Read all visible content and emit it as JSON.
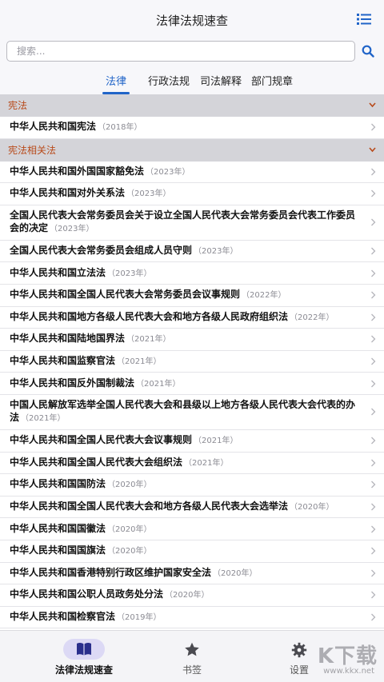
{
  "header": {
    "title": "法律法规速查",
    "menu_icon": "list-icon"
  },
  "search": {
    "placeholder": "搜索..."
  },
  "tabs": [
    {
      "label": "法律",
      "active": true
    },
    {
      "label": "行政法规",
      "active": false
    },
    {
      "label": "司法解释",
      "active": false
    },
    {
      "label": "部门规章",
      "active": false
    }
  ],
  "sections": [
    {
      "title": "宪法",
      "icon": "chevron-down-icon"
    },
    {
      "title": "宪法相关法",
      "icon": "chevron-down-icon"
    }
  ],
  "items": [
    {
      "name": "中华人民共和国宪法",
      "year": "（2018年）"
    },
    {
      "name": "中华人民共和国外国国家豁免法",
      "year": "（2023年）"
    },
    {
      "name": "中华人民共和国对外关系法",
      "year": "（2023年）"
    },
    {
      "name": "全国人民代表大会常务委员会关于设立全国人民代表大会常务委员会代表工作委员会的决定",
      "year": "（2023年）"
    },
    {
      "name": "全国人民代表大会常务委员会组成人员守则",
      "year": "（2023年）"
    },
    {
      "name": "中华人民共和国立法法",
      "year": "（2023年）"
    },
    {
      "name": "中华人民共和国全国人民代表大会常务委员会议事规则",
      "year": "（2022年）"
    },
    {
      "name": "中华人民共和国地方各级人民代表大会和地方各级人民政府组织法",
      "year": "（2022年）"
    },
    {
      "name": "中华人民共和国陆地国界法",
      "year": "（2021年）"
    },
    {
      "name": "中华人民共和国监察官法",
      "year": "（2021年）"
    },
    {
      "name": "中华人民共和国反外国制裁法",
      "year": "（2021年）"
    },
    {
      "name": "中国人民解放军选举全国人民代表大会和县级以上地方各级人民代表大会代表的办法",
      "year": "（2021年）"
    },
    {
      "name": "中华人民共和国全国人民代表大会议事规则",
      "year": "（2021年）"
    },
    {
      "name": "中华人民共和国全国人民代表大会组织法",
      "year": "（2021年）"
    },
    {
      "name": "中华人民共和国国防法",
      "year": "（2020年）"
    },
    {
      "name": "中华人民共和国全国人民代表大会和地方各级人民代表大会选举法",
      "year": "（2020年）"
    },
    {
      "name": "中华人民共和国国徽法",
      "year": "（2020年）"
    },
    {
      "name": "中华人民共和国国旗法",
      "year": "（2020年）"
    },
    {
      "name": "中华人民共和国香港特别行政区维护国家安全法",
      "year": "（2020年）"
    },
    {
      "name": "中华人民共和国公职人员政务处分法",
      "year": "（2020年）"
    },
    {
      "name": "中华人民共和国检察官法",
      "year": "（2019年）"
    }
  ],
  "bottom_nav": [
    {
      "label": "法律法规速查",
      "icon": "book-icon",
      "active": true
    },
    {
      "label": "书签",
      "icon": "star-icon",
      "active": false
    },
    {
      "label": "设置",
      "icon": "gear-icon",
      "active": false
    }
  ],
  "watermark": {
    "text": "K下载",
    "url": "www.kkx.net"
  },
  "colors": {
    "accent": "#2064c8",
    "section_text": "#b84a1a",
    "section_bg": "#d4d4d9"
  }
}
